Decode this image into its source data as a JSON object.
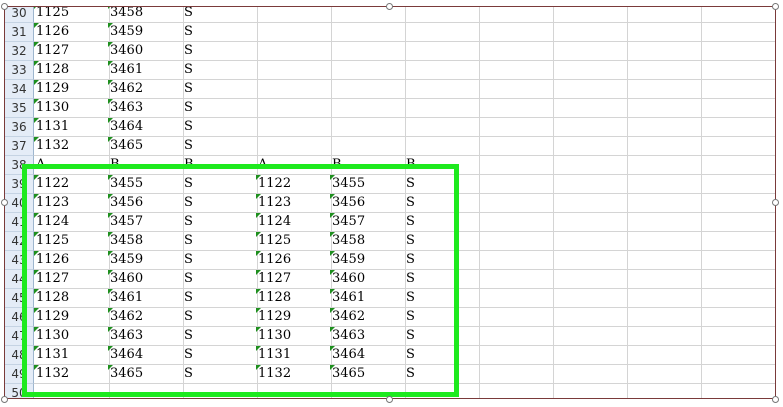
{
  "colors": {
    "highlight": "#1eea1e",
    "row_header_bg": "#e4ecf7",
    "frame": "#7a3a3a"
  },
  "rows": [
    {
      "num": "30",
      "cells": [
        "1125",
        "3458",
        "S",
        "",
        "",
        "",
        "",
        "",
        "",
        ""
      ]
    },
    {
      "num": "31",
      "cells": [
        "1126",
        "3459",
        "S",
        "",
        "",
        "",
        "",
        "",
        "",
        ""
      ]
    },
    {
      "num": "32",
      "cells": [
        "1127",
        "3460",
        "S",
        "",
        "",
        "",
        "",
        "",
        "",
        ""
      ]
    },
    {
      "num": "33",
      "cells": [
        "1128",
        "3461",
        "S",
        "",
        "",
        "",
        "",
        "",
        "",
        ""
      ]
    },
    {
      "num": "34",
      "cells": [
        "1129",
        "3462",
        "S",
        "",
        "",
        "",
        "",
        "",
        "",
        ""
      ]
    },
    {
      "num": "35",
      "cells": [
        "1130",
        "3463",
        "S",
        "",
        "",
        "",
        "",
        "",
        "",
        ""
      ]
    },
    {
      "num": "36",
      "cells": [
        "1131",
        "3464",
        "S",
        "",
        "",
        "",
        "",
        "",
        "",
        ""
      ]
    },
    {
      "num": "37",
      "cells": [
        "1132",
        "3465",
        "S",
        "",
        "",
        "",
        "",
        "",
        "",
        ""
      ]
    },
    {
      "num": "38",
      "cells": [
        "A",
        "B",
        "B",
        "A",
        "B",
        "B",
        "",
        "",
        "",
        ""
      ]
    },
    {
      "num": "39",
      "cells": [
        "1122",
        "3455",
        "S",
        "1122",
        "3455",
        "S",
        "",
        "",
        "",
        ""
      ]
    },
    {
      "num": "40",
      "cells": [
        "1123",
        "3456",
        "S",
        "1123",
        "3456",
        "S",
        "",
        "",
        "",
        ""
      ]
    },
    {
      "num": "41",
      "cells": [
        "1124",
        "3457",
        "S",
        "1124",
        "3457",
        "S",
        "",
        "",
        "",
        ""
      ]
    },
    {
      "num": "42",
      "cells": [
        "1125",
        "3458",
        "S",
        "1125",
        "3458",
        "S",
        "",
        "",
        "",
        ""
      ]
    },
    {
      "num": "43",
      "cells": [
        "1126",
        "3459",
        "S",
        "1126",
        "3459",
        "S",
        "",
        "",
        "",
        ""
      ]
    },
    {
      "num": "44",
      "cells": [
        "1127",
        "3460",
        "S",
        "1127",
        "3460",
        "S",
        "",
        "",
        "",
        ""
      ]
    },
    {
      "num": "45",
      "cells": [
        "1128",
        "3461",
        "S",
        "1128",
        "3461",
        "S",
        "",
        "",
        "",
        ""
      ]
    },
    {
      "num": "46",
      "cells": [
        "1129",
        "3462",
        "S",
        "1129",
        "3462",
        "S",
        "",
        "",
        "",
        ""
      ]
    },
    {
      "num": "47",
      "cells": [
        "1130",
        "3463",
        "S",
        "1130",
        "3463",
        "S",
        "",
        "",
        "",
        ""
      ]
    },
    {
      "num": "48",
      "cells": [
        "1131",
        "3464",
        "S",
        "1131",
        "3464",
        "S",
        "",
        "",
        "",
        ""
      ]
    },
    {
      "num": "49",
      "cells": [
        "1132",
        "3465",
        "S",
        "1132",
        "3465",
        "S",
        "",
        "",
        "",
        ""
      ]
    },
    {
      "num": "50",
      "cells": [
        "",
        "",
        "",
        "",
        "",
        "",
        "",
        "",
        "",
        ""
      ]
    }
  ]
}
